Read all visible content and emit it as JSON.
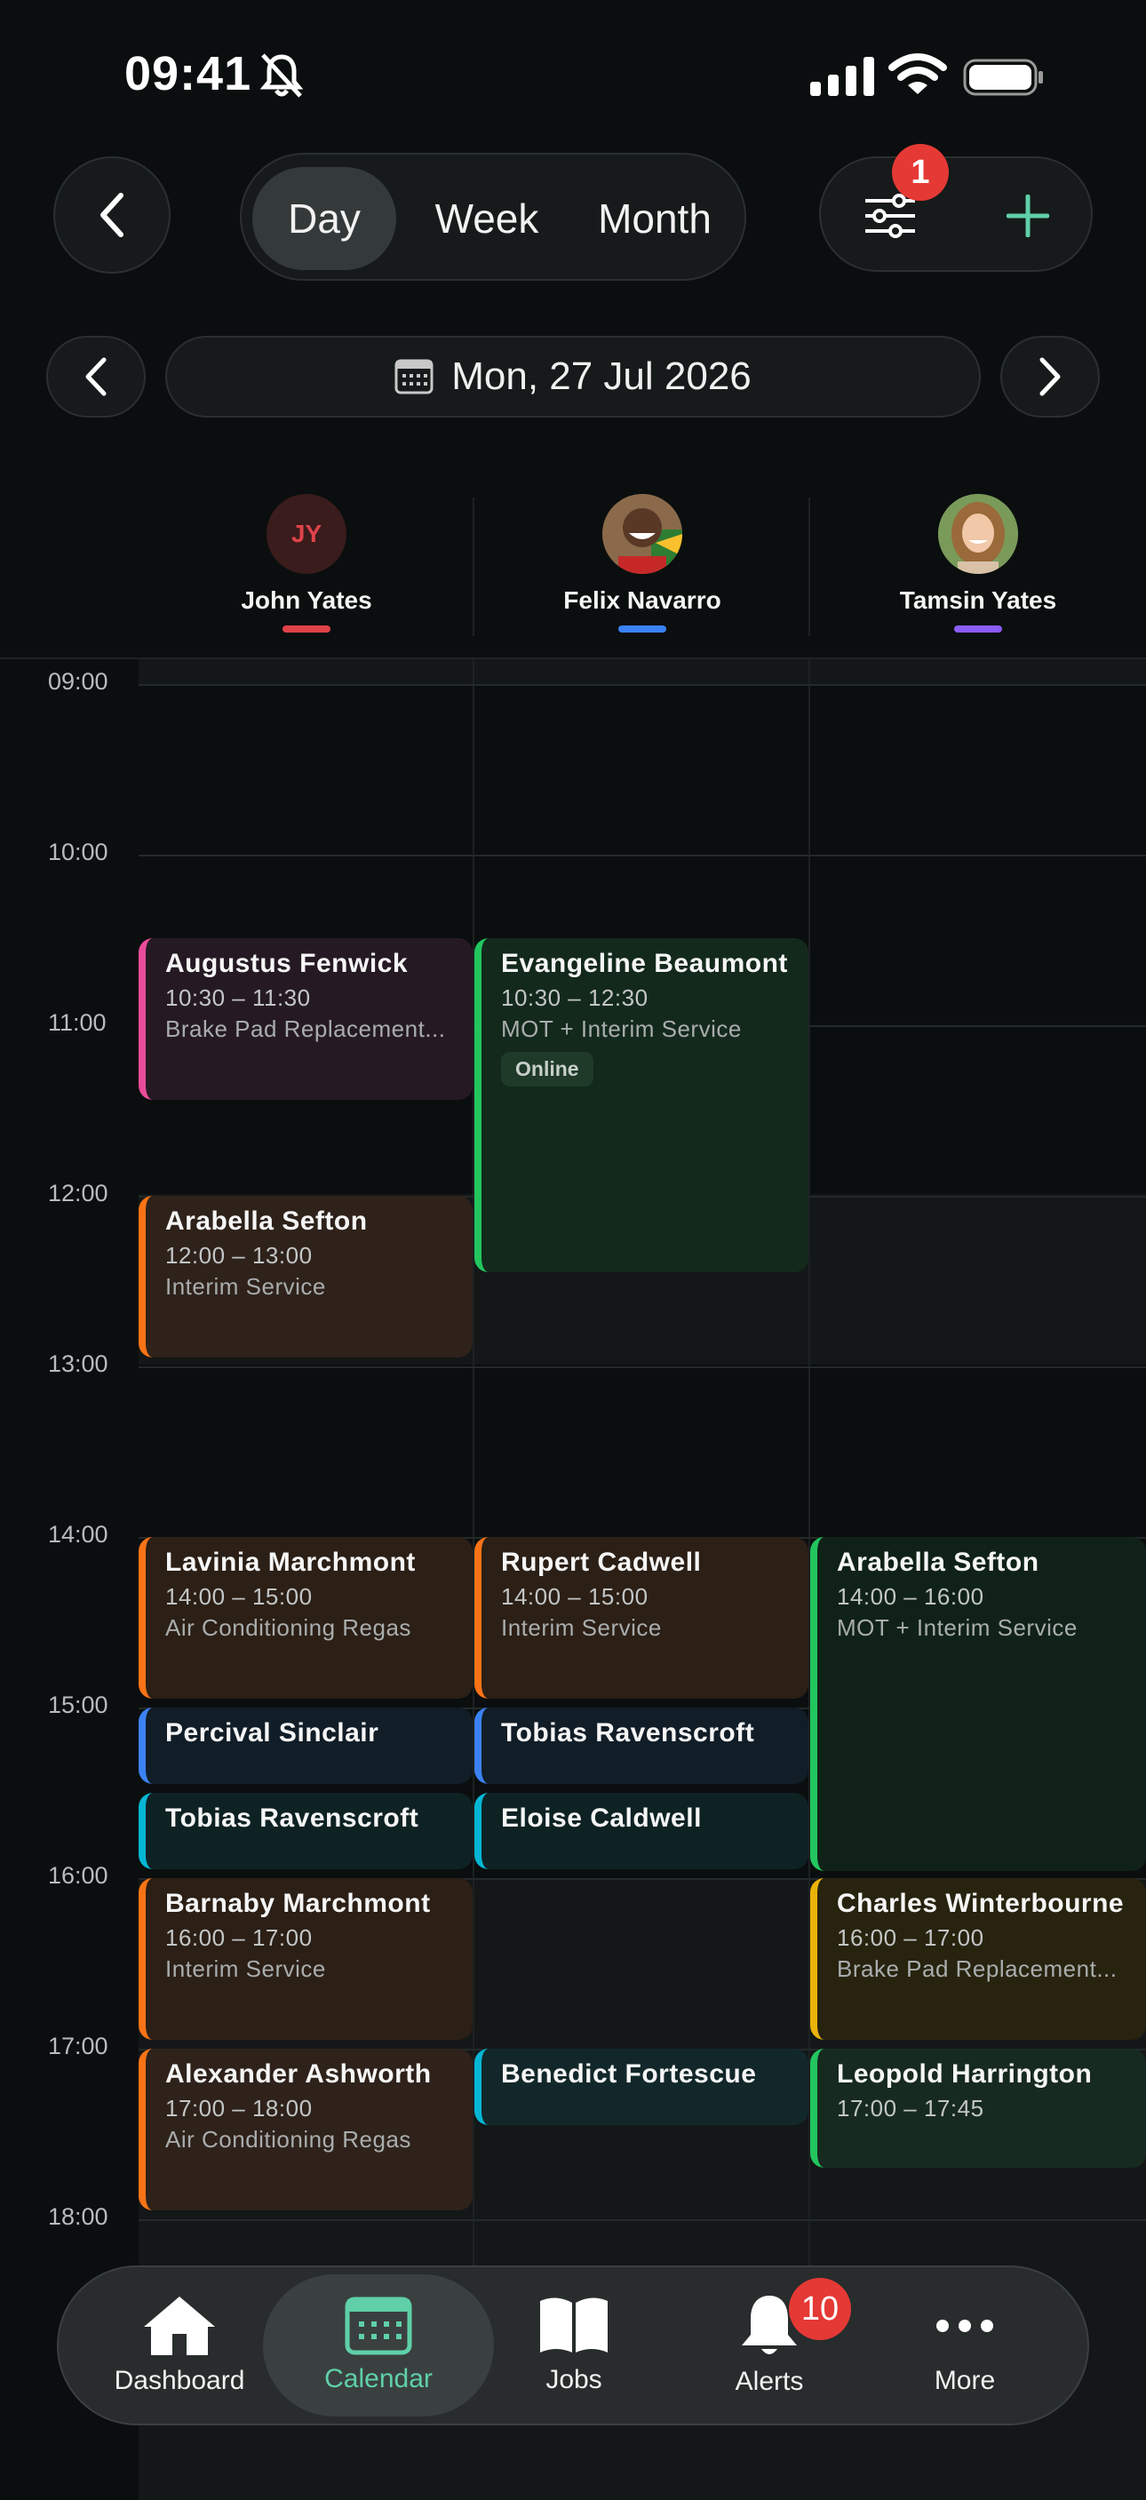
{
  "status_bar": {
    "time": "09:41"
  },
  "header": {
    "view_tabs": [
      {
        "label": "Day"
      },
      {
        "label": "Week"
      },
      {
        "label": "Month"
      }
    ],
    "filter_badge": "1"
  },
  "date_nav": {
    "date": "Mon, 27 Jul 2026"
  },
  "staff": [
    {
      "name": "John Yates",
      "initials": "JY",
      "color": "#e0424a"
    },
    {
      "name": "Felix Navarro",
      "color": "#3b82f6"
    },
    {
      "name": "Tamsin Yates",
      "color": "#8b5cf6"
    }
  ],
  "hours": [
    "09:00",
    "10:00",
    "11:00",
    "12:00",
    "13:00",
    "14:00",
    "15:00",
    "16:00",
    "17:00",
    "18:00"
  ],
  "events": [
    {
      "name": "Augustus Fenwick",
      "time": "10:30 – 11:30",
      "service": "Brake Pad Replacement...",
      "color": "#e84c9a"
    },
    {
      "name": "Evangeline Beaumont",
      "time": "10:30 – 12:30",
      "service": "MOT + Interim Service",
      "tag": "Online",
      "color": "#22c55e"
    },
    {
      "name": "Arabella Sefton",
      "time": "12:00 – 13:00",
      "service": "Interim Service",
      "color": "#f97316"
    },
    {
      "name": "Lavinia Marchmont",
      "time": "14:00 – 15:00",
      "service": "Air Conditioning Regas",
      "color": "#f97316"
    },
    {
      "name": "Rupert Cadwell",
      "time": "14:00 – 15:00",
      "service": "Interim Service",
      "color": "#f97316"
    },
    {
      "name": "Arabella Sefton",
      "time": "14:00 – 16:00",
      "service": "MOT + Interim Service",
      "color": "#22c55e"
    },
    {
      "name": "Percival Sinclair",
      "color": "#3b82f6"
    },
    {
      "name": "Tobias Ravenscroft",
      "color": "#3b82f6"
    },
    {
      "name": "Tobias Ravenscroft",
      "color": "#06b6d4"
    },
    {
      "name": "Eloise Caldwell",
      "color": "#06b6d4"
    },
    {
      "name": "Barnaby Marchmont",
      "time": "16:00 – 17:00",
      "service": "Interim Service",
      "color": "#f97316"
    },
    {
      "name": "Charles Winterbourne",
      "time": "16:00 – 17:00",
      "service": "Brake Pad Replacement...",
      "color": "#eab308"
    },
    {
      "name": "Alexander Ashworth",
      "time": "17:00 – 18:00",
      "service": "Air Conditioning Regas",
      "color": "#f97316"
    },
    {
      "name": "Benedict Fortescue",
      "color": "#06b6d4"
    },
    {
      "name": "Leopold Harrington",
      "time": "17:00 – 17:45",
      "color": "#22c55e"
    }
  ],
  "bottom_nav": {
    "items": [
      {
        "label": "Dashboard"
      },
      {
        "label": "Calendar"
      },
      {
        "label": "Jobs"
      },
      {
        "label": "Alerts"
      },
      {
        "label": "More"
      }
    ],
    "alerts_badge": "10",
    "accent": "#5fd0a8"
  }
}
